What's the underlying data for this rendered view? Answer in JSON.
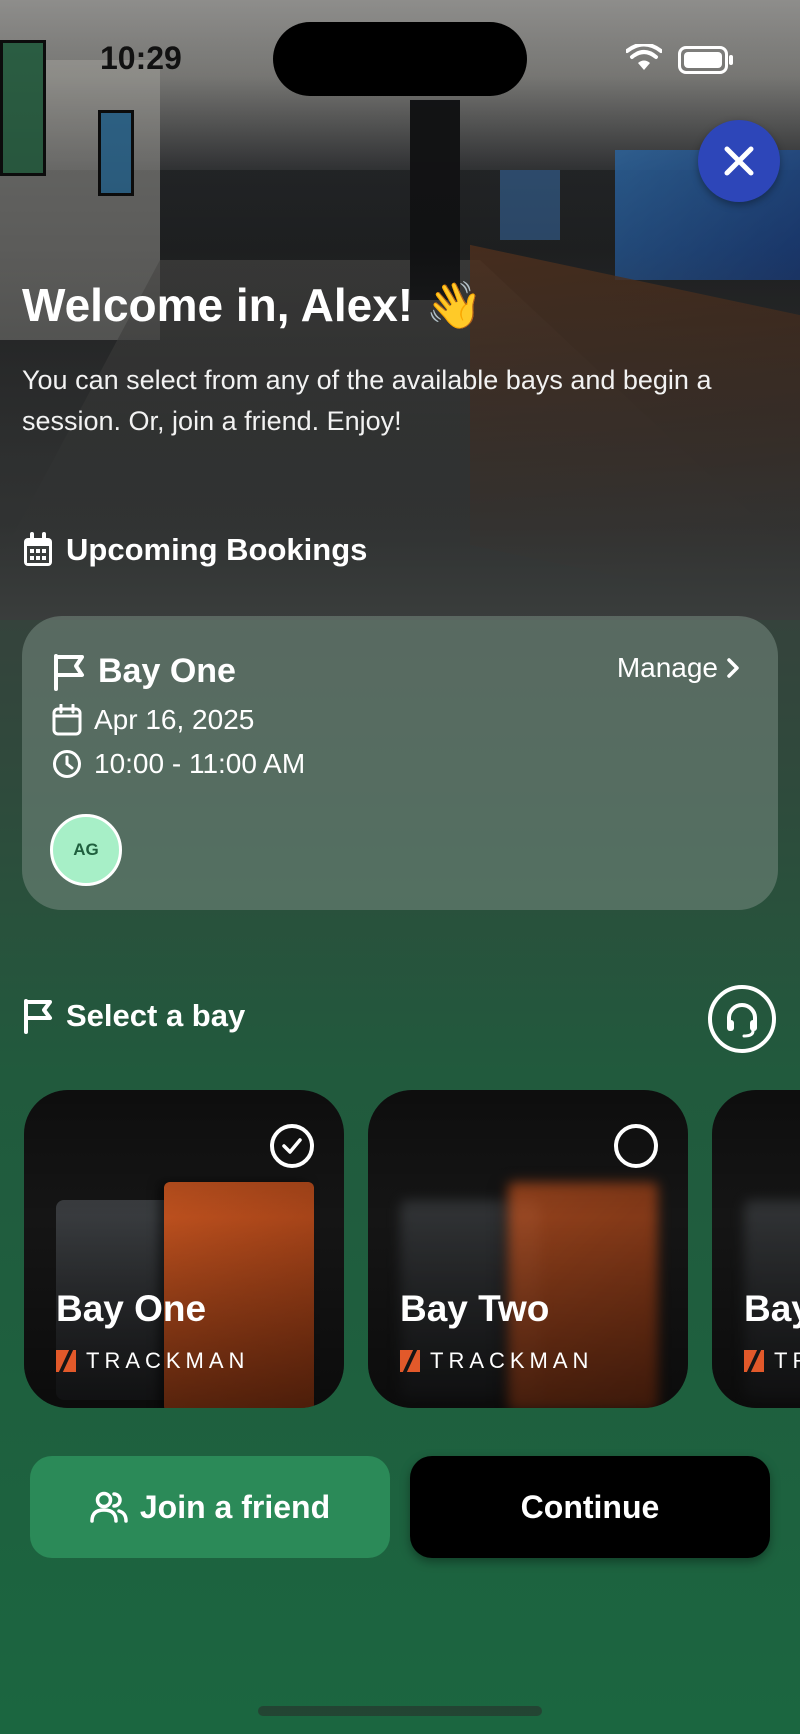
{
  "status_bar": {
    "time": "10:29"
  },
  "header": {
    "welcome": "Welcome in, Alex! 👋",
    "subtitle": "You can select from any of the available bays and begin a session. Or, join a friend. Enjoy!"
  },
  "upcoming": {
    "heading": "Upcoming Bookings",
    "booking": {
      "bay": "Bay One",
      "manage_label": "Manage",
      "date": "Apr 16, 2025",
      "time": "10:00 - 11:00 AM",
      "participants": [
        "AG"
      ]
    }
  },
  "bay_select": {
    "heading": "Select a bay",
    "bays": [
      {
        "name": "Bay One",
        "brand": "TRACKMAN",
        "selected": true
      },
      {
        "name": "Bay Two",
        "brand": "TRACKMAN",
        "selected": false
      },
      {
        "name": "Bay",
        "brand": "TR",
        "selected": false
      }
    ]
  },
  "actions": {
    "join_label": "Join a friend",
    "continue_label": "Continue"
  },
  "colors": {
    "close_button": "#2d46b9",
    "join_button": "#2b8a58",
    "continue_button": "#000000",
    "avatar_bg": "#a7efc7",
    "trackman_orange": "#e2592a"
  },
  "icons": {
    "close": "close-icon",
    "calendar": "calendar-icon",
    "flag": "flag-icon",
    "clock": "clock-icon",
    "chevron": "chevron-right-icon",
    "support": "headset-icon",
    "users": "users-icon",
    "check": "check-circle-icon",
    "radio": "radio-empty-icon"
  }
}
